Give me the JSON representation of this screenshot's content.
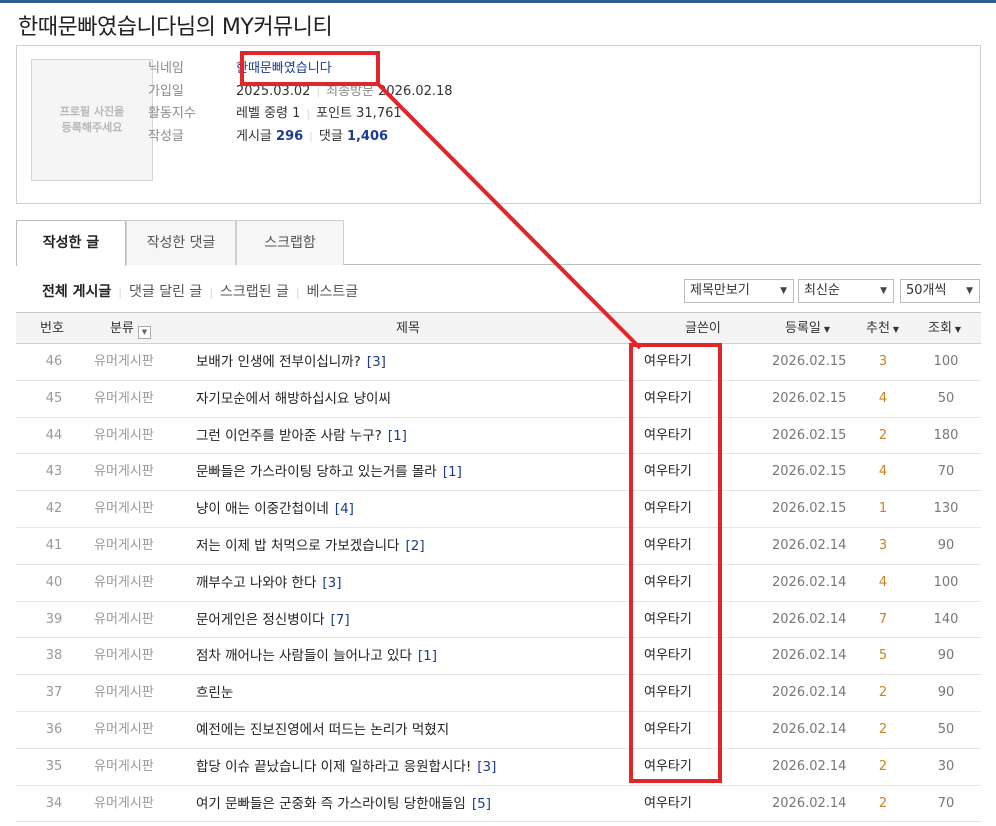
{
  "page": {
    "title": "한때문빠였습니다님의 MY커뮤니티"
  },
  "profile": {
    "photo_placeholder": "프로필 사진을\n등록해주세요",
    "nickname_label": "닉네임",
    "nickname": "한때문빠였습니다",
    "join_label": "가입일",
    "join_date": "2025.03.02",
    "last_visit_label": "최종방문",
    "last_visit": "2026.02.18",
    "activity_label": "활동지수",
    "level_label": "레벨",
    "level_value": "중령 1",
    "points_label": "포인트",
    "points_value": "31,761",
    "posts_label": "작성글",
    "post_count_label": "게시글",
    "post_count": "296",
    "comment_count_label": "댓글",
    "comment_count": "1,406"
  },
  "tabs": [
    {
      "label": "작성한 글",
      "active": true
    },
    {
      "label": "작성한 댓글",
      "active": false
    },
    {
      "label": "스크랩함",
      "active": false
    }
  ],
  "filters": [
    "전체 게시글",
    "댓글 달린 글",
    "스크랩된 글",
    "베스트글"
  ],
  "selects": {
    "view_mode": "제목만보기",
    "sort": "최신순",
    "per_page": "50개씩"
  },
  "columns": {
    "num": "번호",
    "category": "분류",
    "title": "제목",
    "author": "글쓴이",
    "date": "등록일",
    "rec": "추천",
    "views": "조회"
  },
  "posts": [
    {
      "num": "46",
      "category": "유머게시판",
      "title": "보배가 인생에 전부이십니까?",
      "comments": "[3]",
      "author": "여우타기",
      "date": "2026.02.15",
      "rec": "3",
      "views": "100"
    },
    {
      "num": "45",
      "category": "유머게시판",
      "title": "자기모순에서 해방하십시요 냥이씨",
      "comments": "",
      "author": "여우타기",
      "date": "2026.02.15",
      "rec": "4",
      "views": "50"
    },
    {
      "num": "44",
      "category": "유머게시판",
      "title": "그런 이언주를 받아준 사람 누구?",
      "comments": "[1]",
      "author": "여우타기",
      "date": "2026.02.15",
      "rec": "2",
      "views": "180"
    },
    {
      "num": "43",
      "category": "유머게시판",
      "title": "문빠들은 가스라이팅 당하고 있는거를 몰라",
      "comments": "[1]",
      "author": "여우타기",
      "date": "2026.02.15",
      "rec": "4",
      "views": "70"
    },
    {
      "num": "42",
      "category": "유머게시판",
      "title": "냥이 애는 이중간첩이네",
      "comments": "[4]",
      "author": "여우타기",
      "date": "2026.02.15",
      "rec": "1",
      "views": "130"
    },
    {
      "num": "41",
      "category": "유머게시판",
      "title": "저는 이제 밥 처먹으로 가보겠습니다",
      "comments": "[2]",
      "author": "여우타기",
      "date": "2026.02.14",
      "rec": "3",
      "views": "90"
    },
    {
      "num": "40",
      "category": "유머게시판",
      "title": "깨부수고 나와야 한다",
      "comments": "[3]",
      "author": "여우타기",
      "date": "2026.02.14",
      "rec": "4",
      "views": "100"
    },
    {
      "num": "39",
      "category": "유머게시판",
      "title": "문어게인은 정신병이다",
      "comments": "[7]",
      "author": "여우타기",
      "date": "2026.02.14",
      "rec": "7",
      "views": "140"
    },
    {
      "num": "38",
      "category": "유머게시판",
      "title": "점차 깨어나는 사람들이 늘어나고 있다",
      "comments": "[1]",
      "author": "여우타기",
      "date": "2026.02.14",
      "rec": "5",
      "views": "90"
    },
    {
      "num": "37",
      "category": "유머게시판",
      "title": "흐린눈",
      "comments": "",
      "author": "여우타기",
      "date": "2026.02.14",
      "rec": "2",
      "views": "90"
    },
    {
      "num": "36",
      "category": "유머게시판",
      "title": "예전에는 진보진영에서 떠드는 논리가 먹혔지",
      "comments": "",
      "author": "여우타기",
      "date": "2026.02.14",
      "rec": "2",
      "views": "50"
    },
    {
      "num": "35",
      "category": "유머게시판",
      "title": "합당 이슈 끝났습니다 이제 일하라고 응원합시다!",
      "comments": "[3]",
      "author": "여우타기",
      "date": "2026.02.14",
      "rec": "2",
      "views": "30"
    },
    {
      "num": "34",
      "category": "유머게시판",
      "title": "여기 문빠들은 군중화 즉 가스라이팅 당한애들임",
      "comments": "[5]",
      "author": "여우타기",
      "date": "2026.02.14",
      "rec": "2",
      "views": "70"
    }
  ],
  "colors": {
    "highlight": "#e2252b",
    "count": "#1d3c8f",
    "recommend": "#c8841b",
    "topbar": "#2f5d8c"
  }
}
